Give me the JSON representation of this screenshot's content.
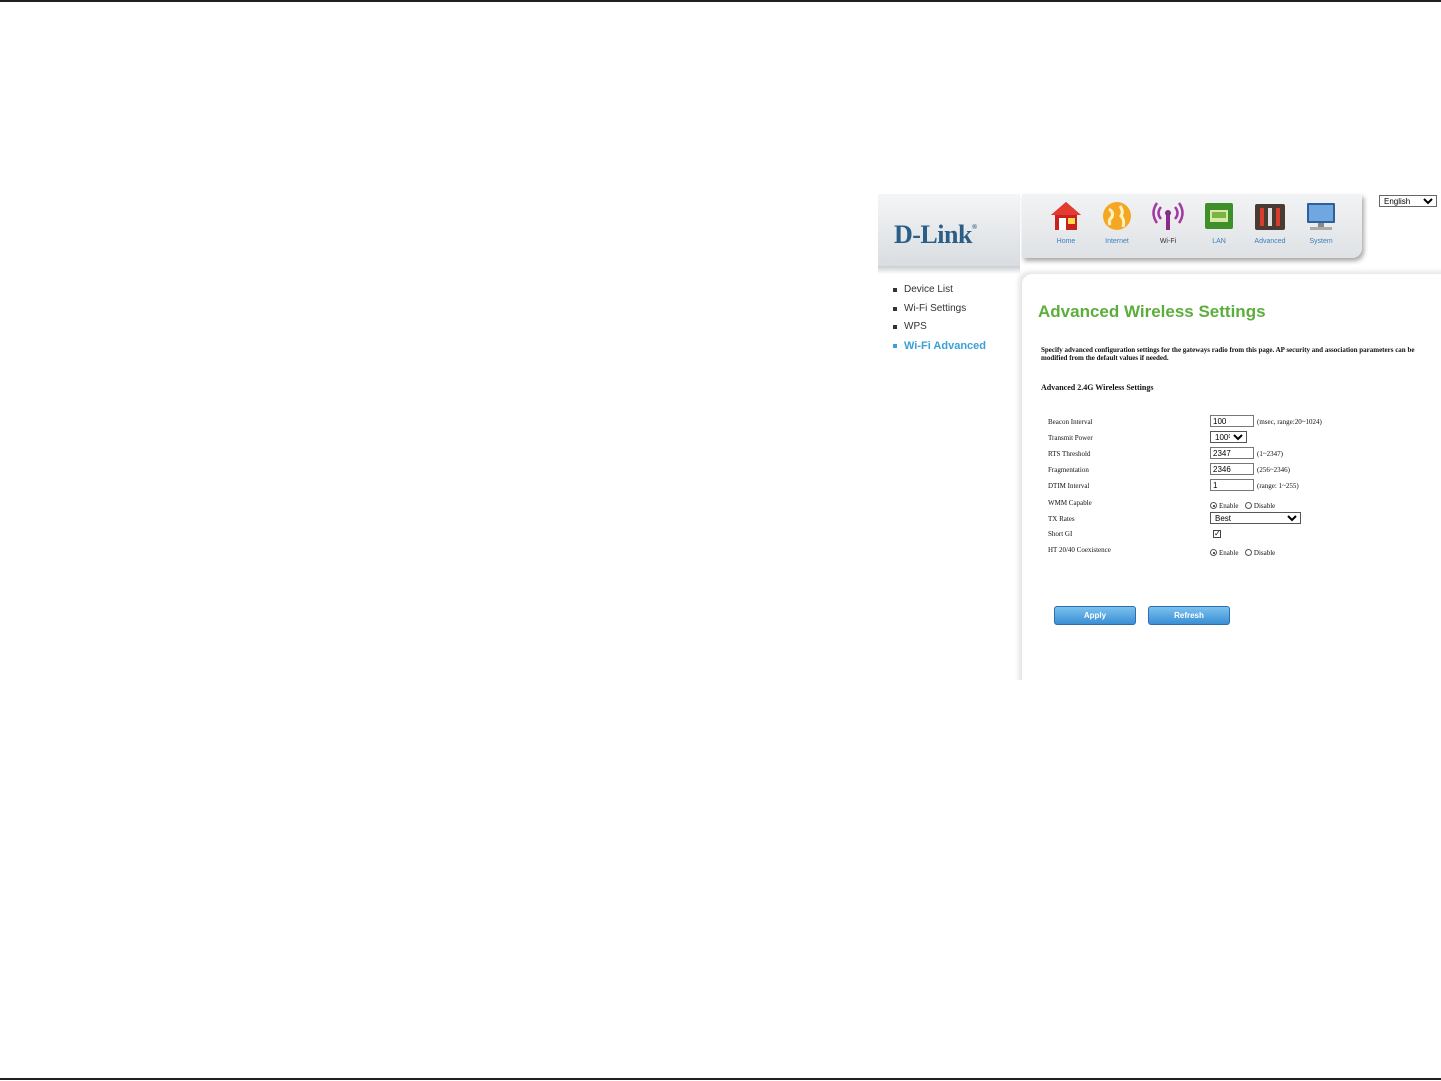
{
  "header": {
    "logo": "D-Link",
    "language": "English"
  },
  "nav": [
    {
      "label": "Home",
      "icon": "home-icon"
    },
    {
      "label": "Internet",
      "icon": "globe-icon"
    },
    {
      "label": "Wi-Fi",
      "icon": "wifi-icon"
    },
    {
      "label": "LAN",
      "icon": "lan-icon"
    },
    {
      "label": "Advanced",
      "icon": "tools-icon"
    },
    {
      "label": "System",
      "icon": "monitor-icon"
    }
  ],
  "sidebar": {
    "items": [
      {
        "label": "Device List"
      },
      {
        "label": "Wi-Fi Settings"
      },
      {
        "label": "WPS"
      },
      {
        "label": "Wi-Fi Advanced"
      }
    ]
  },
  "main": {
    "title": "Advanced Wireless Settings",
    "description": "Specify advanced configuration settings for the gateways radio from this page. AP security and association parameters can be modified from the default values if needed.",
    "section_title": "Advanced 2.4G Wireless Settings",
    "fields": {
      "beacon_interval": {
        "label": "Beacon Interval",
        "value": "100",
        "hint": "(msec, range:20~1024)"
      },
      "transmit_power": {
        "label": "Transmit Power",
        "value": "100%"
      },
      "rts_threshold": {
        "label": "RTS Threshold",
        "value": "2347",
        "hint": "(1~2347)"
      },
      "fragmentation": {
        "label": "Fragmentation",
        "value": "2346",
        "hint": "(256~2346)"
      },
      "dtim_interval": {
        "label": "DTIM Interval",
        "value": "1",
        "hint": "(range: 1~255)"
      },
      "wmm_capable": {
        "label": "WMM Capable",
        "enable": "Enable",
        "disable": "Disable"
      },
      "tx_rates": {
        "label": "TX Rates",
        "value": "Best"
      },
      "short_gi": {
        "label": "Short GI"
      },
      "ht_coexistence": {
        "label": "HT 20/40 Coexistence",
        "enable": "Enable",
        "disable": "Disable"
      }
    },
    "buttons": {
      "apply": "Apply",
      "refresh": "Refresh"
    }
  },
  "colors": {
    "title_green": "#5cae3c",
    "active_blue": "#3aa0d8",
    "logo_blue": "#2b5e86",
    "button_blue": "#3a8fd4"
  }
}
